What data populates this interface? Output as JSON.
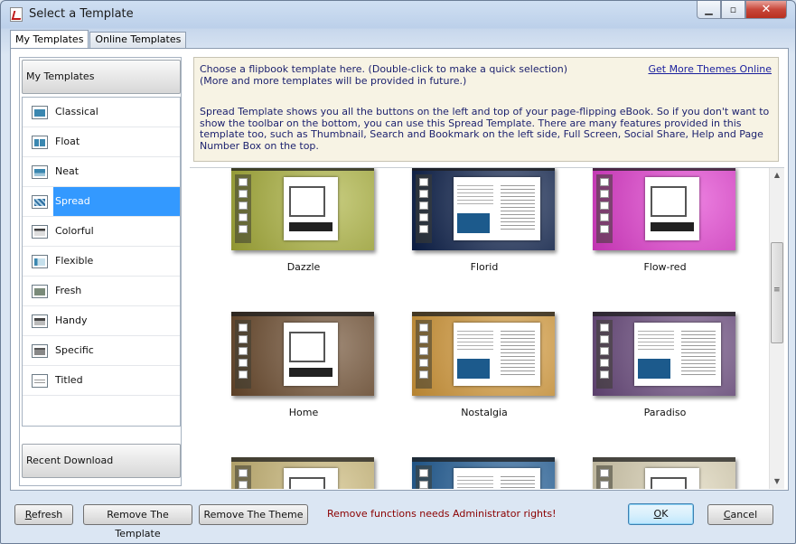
{
  "window": {
    "title": "Select a Template",
    "controls": {
      "minimize_icon": "minimize-icon",
      "maximize_icon": "maximize-icon",
      "close_icon": "close-icon"
    }
  },
  "tabs": [
    {
      "label": "My Templates",
      "active": true
    },
    {
      "label": "Online Templates",
      "active": false
    }
  ],
  "sidebar": {
    "header": "My Templates",
    "items": [
      {
        "label": "Classical"
      },
      {
        "label": "Float"
      },
      {
        "label": "Neat"
      },
      {
        "label": "Spread",
        "selected": true
      },
      {
        "label": "Colorful"
      },
      {
        "label": "Flexible"
      },
      {
        "label": "Fresh"
      },
      {
        "label": "Handy"
      },
      {
        "label": "Specific"
      },
      {
        "label": "Titled"
      }
    ],
    "footer": "Recent Download"
  },
  "info": {
    "line1": "Choose a flipbook template here. (Double-click to make a quick selection)",
    "line2": "(More and more templates will be provided in future.)",
    "link": "Get More Themes Online",
    "description": "Spread Template shows you all the buttons on the left and top of your page-flipping eBook. So if you don't want to show the toolbar on the bottom, you can use this Spread Template. There are many features provided in this template too, such as Thumbnail, Search and Bookmark on the left side, Full Screen, Social Share, Help and Page Number Box on the top."
  },
  "gallery": {
    "rows": [
      [
        {
          "name": "Dazzle"
        },
        {
          "name": "Florid"
        },
        {
          "name": "Flow-red"
        }
      ],
      [
        {
          "name": "Home"
        },
        {
          "name": "Nostalgia"
        },
        {
          "name": "Paradiso"
        }
      ],
      [
        {
          "name": ""
        },
        {
          "name": ""
        },
        {
          "name": ""
        }
      ]
    ],
    "theme_colors": {
      "Dazzle": "#a9b03a",
      "Florid": "#0b1f4a",
      "Flow-red": "#e23ccf",
      "Home": "#6b4a2c",
      "Nostalgia": "#d59a3a",
      "Paradiso": "#6a4a7e",
      "r3c1": "#c9b675",
      "r3c2": "#1e5b95",
      "r3c3": "#d9d0b2"
    }
  },
  "buttons": {
    "refresh": {
      "accel": "R",
      "rest": "efresh"
    },
    "remove_template": "Remove The Template",
    "remove_theme": "Remove The Theme",
    "ok": {
      "accel": "O",
      "rest": "K"
    },
    "cancel": {
      "accel": "C",
      "rest": "ancel"
    }
  },
  "warning": "Remove functions needs Administrator rights!"
}
